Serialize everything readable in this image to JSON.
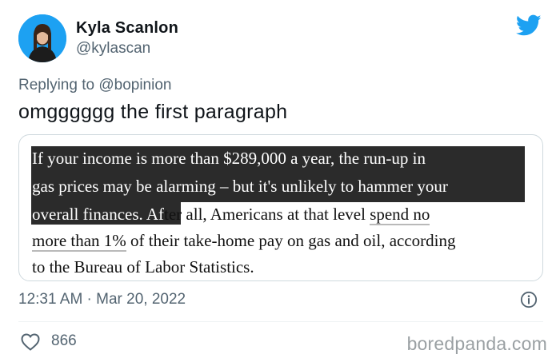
{
  "author": {
    "display_name": "Kyla Scanlon",
    "handle": "@kylascan"
  },
  "reply": {
    "prefix": "Replying to",
    "mention": "@bopinion"
  },
  "tweet": {
    "text": "omgggggg the first paragraph"
  },
  "quoted_excerpt": {
    "line1": "If your income is more than $289,000 a year, the run-up in",
    "line2": "gas prices may be alarming – but it's unlikely to hammer your",
    "line3_highlighted": "overall finances. Af",
    "line3_plain": "ter all, Americans at that level ",
    "line3_link": "spend no",
    "line4_link": "more than 1%",
    "line4_rest": " of their take-home pay on gas and oil, according",
    "line5": "to the Bureau of Labor Statistics."
  },
  "meta": {
    "timestamp": "12:31 AM · Mar 20, 2022"
  },
  "engagement": {
    "likes": "866"
  },
  "watermark": "boredpanda.com",
  "icons": {
    "brand": "twitter-bird-icon",
    "info": "info-icon",
    "like": "heart-icon"
  },
  "colors": {
    "brand_blue": "#1da1f2",
    "secondary_text": "#536471",
    "highlight": "#2b2b2b"
  }
}
